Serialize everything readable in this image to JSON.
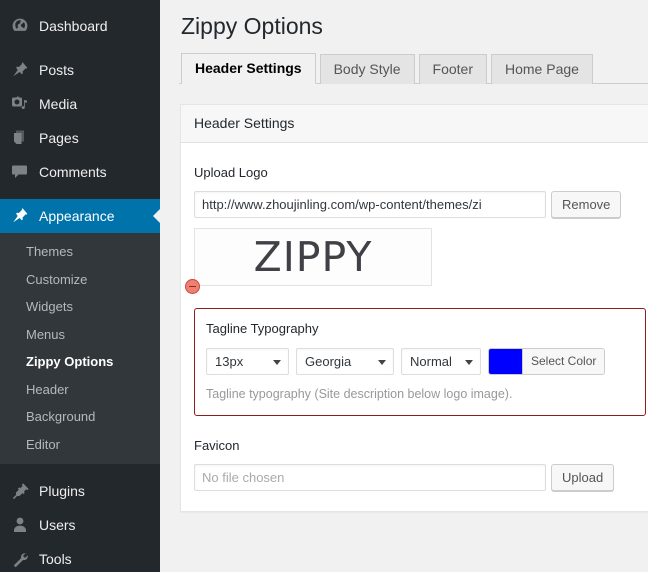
{
  "sidebar": {
    "items": [
      {
        "label": "Dashboard",
        "icon": "dashboard-icon"
      },
      {
        "label": "Posts",
        "icon": "posts-pin-icon"
      },
      {
        "label": "Media",
        "icon": "media-icon"
      },
      {
        "label": "Pages",
        "icon": "pages-icon"
      },
      {
        "label": "Comments",
        "icon": "comments-icon"
      },
      {
        "label": "Appearance",
        "icon": "appearance-brush-icon"
      },
      {
        "label": "Plugins",
        "icon": "plugins-plug-icon"
      },
      {
        "label": "Users",
        "icon": "users-icon"
      },
      {
        "label": "Tools",
        "icon": "tools-wrench-icon"
      }
    ],
    "submenu": [
      {
        "label": "Themes"
      },
      {
        "label": "Customize"
      },
      {
        "label": "Widgets"
      },
      {
        "label": "Menus"
      },
      {
        "label": "Zippy Options"
      },
      {
        "label": "Header"
      },
      {
        "label": "Background"
      },
      {
        "label": "Editor"
      }
    ],
    "active_item": "Appearance",
    "active_subitem": "Zippy Options",
    "highlight_color": "#0073aa"
  },
  "page": {
    "title": "Zippy Options",
    "tabs": [
      {
        "label": "Header Settings"
      },
      {
        "label": "Body Style"
      },
      {
        "label": "Footer"
      },
      {
        "label": "Home Page"
      }
    ],
    "active_tab": "Header Settings"
  },
  "panel": {
    "heading": "Header Settings",
    "upload_logo": {
      "label": "Upload Logo",
      "url_value": "http://www.zhoujinling.com/wp-content/themes/zi",
      "remove_label": "Remove",
      "preview_text": "ZIPPY",
      "remove_badge_name": "remove-logo-badge"
    },
    "tagline_typography": {
      "title": "Tagline Typography",
      "size_value": "13px",
      "family_value": "Georgia",
      "weight_value": "Normal",
      "color_value": "#0000ff",
      "select_color_label": "Select Color",
      "help": "Tagline typography (Site description below logo image).",
      "border_color": "#8b1f1f"
    },
    "favicon": {
      "label": "Favicon",
      "file_placeholder": "No file chosen",
      "upload_label": "Upload"
    }
  }
}
